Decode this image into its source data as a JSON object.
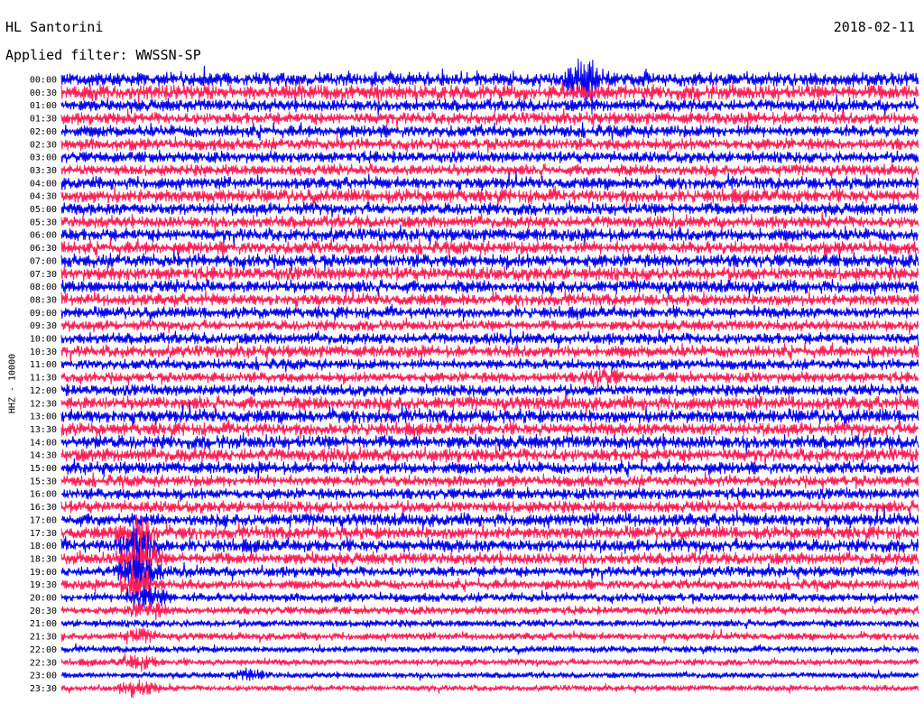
{
  "header": {
    "station": "HL Santorini",
    "date": "2018-02-11",
    "filter": "Applied filter: WWSSN-SP"
  },
  "chart_data": {
    "type": "line",
    "ylabel": "HHZ - 10000",
    "colors": [
      "#0000ee",
      "#ff1f55"
    ],
    "rows": [
      "00:00",
      "00:30",
      "01:00",
      "01:30",
      "02:00",
      "02:30",
      "03:00",
      "03:30",
      "04:00",
      "04:30",
      "05:00",
      "05:30",
      "06:00",
      "06:30",
      "07:00",
      "07:30",
      "08:00",
      "08:30",
      "09:00",
      "09:30",
      "10:00",
      "10:30",
      "11:00",
      "11:30",
      "12:00",
      "12:30",
      "13:00",
      "13:30",
      "14:00",
      "14:30",
      "15:00",
      "15:30",
      "16:00",
      "16:30",
      "17:00",
      "17:30",
      "18:00",
      "18:30",
      "19:00",
      "19:30",
      "20:00",
      "20:30",
      "21:00",
      "21:30",
      "22:00",
      "22:30",
      "23:00",
      "23:30"
    ],
    "amplitude": [
      0.9,
      1.0,
      0.8,
      0.8,
      0.8,
      0.8,
      0.75,
      0.75,
      0.8,
      0.9,
      0.8,
      0.8,
      0.85,
      0.85,
      0.9,
      0.9,
      0.85,
      0.8,
      0.75,
      0.7,
      0.75,
      0.8,
      0.7,
      0.7,
      0.75,
      0.9,
      0.9,
      0.85,
      0.9,
      0.9,
      0.8,
      0.75,
      0.75,
      0.8,
      0.85,
      0.85,
      0.85,
      0.8,
      0.7,
      0.65,
      0.6,
      0.55,
      0.5,
      0.5,
      0.45,
      0.45,
      0.4,
      0.4
    ],
    "events": [
      {
        "row": "00:00",
        "position": 0.61,
        "strength": 3.0
      },
      {
        "row": "11:30",
        "position": 0.63,
        "strength": 1.5
      },
      {
        "row": "17:30",
        "position": 0.09,
        "strength": 2.0
      },
      {
        "row": "18:00",
        "position": 0.09,
        "strength": 3.0
      },
      {
        "row": "18:30",
        "position": 0.09,
        "strength": 3.5
      },
      {
        "row": "19:00",
        "position": 0.09,
        "strength": 4.0
      },
      {
        "row": "19:30",
        "position": 0.09,
        "strength": 3.5
      },
      {
        "row": "20:00",
        "position": 0.1,
        "strength": 3.0
      },
      {
        "row": "20:30",
        "position": 0.1,
        "strength": 2.0
      },
      {
        "row": "21:30",
        "position": 0.09,
        "strength": 1.5
      },
      {
        "row": "22:30",
        "position": 0.09,
        "strength": 2.0
      },
      {
        "row": "23:00",
        "position": 0.22,
        "strength": 1.5
      },
      {
        "row": "23:30",
        "position": 0.09,
        "strength": 2.5
      }
    ]
  }
}
